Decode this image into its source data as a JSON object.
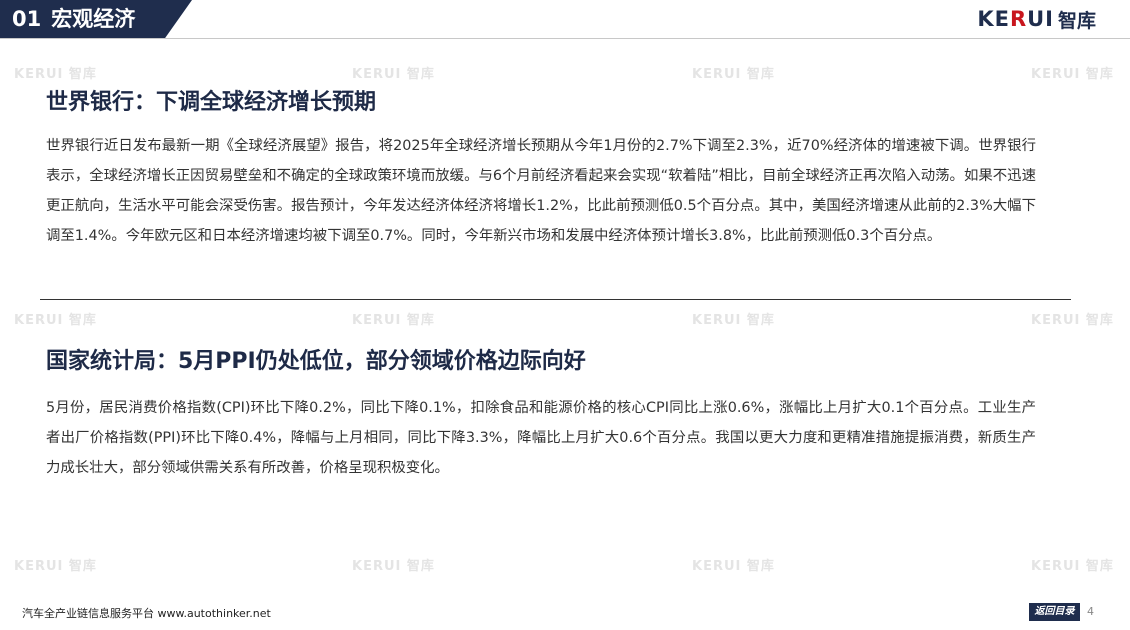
{
  "header": {
    "section_number": "01",
    "section_title": "宏观经济",
    "brand_word_a": "KE",
    "brand_word_b": "R",
    "brand_word_c": "UI",
    "brand_cn": "智库"
  },
  "watermark": {
    "text": "KERUI 智库"
  },
  "articles": [
    {
      "title": "世界银行：下调全球经济增长预期",
      "body": "世界银行近日发布最新一期《全球经济展望》报告，将2025年全球经济增长预期从今年1月份的2.7%下调至2.3%，近70%经济体的增速被下调。世界银行表示，全球经济增长正因贸易壁垒和不确定的全球政策环境而放缓。与6个月前经济看起来会实现“软着陆”相比，目前全球经济正再次陷入动荡。如果不迅速更正航向，生活水平可能会深受伤害。报告预计，今年发达经济体经济将增长1.2%，比此前预测低0.5个百分点。其中，美国经济增速从此前的2.3%大幅下调至1.4%。今年欧元区和日本经济增速均被下调至0.7%。同时，今年新兴市场和发展中经济体预计增长3.8%，比此前预测低0.3个百分点。"
    },
    {
      "title": "国家统计局：5月PPI仍处低位，部分领域价格边际向好",
      "body": "5月份，居民消费价格指数(CPI)环比下降0.2%，同比下降0.1%，扣除食品和能源价格的核心CPI同比上涨0.6%，涨幅比上月扩大0.1个百分点。工业生产者出厂价格指数(PPI)环比下降0.4%，降幅与上月相同，同比下降3.3%，降幅比上月扩大0.6个百分点。我国以更大力度和更精准措施提振消费，新质生产力成长壮大，部分领域供需关系有所改善，价格呈现积极变化。"
    }
  ],
  "footer": {
    "platform_text": "汽车全产业链信息服务平台 www.autothinker.net",
    "back_label": "返回目录",
    "page_number": "4"
  },
  "colors": {
    "navy": "#1f2d4d",
    "brand_red": "#c8161e"
  }
}
